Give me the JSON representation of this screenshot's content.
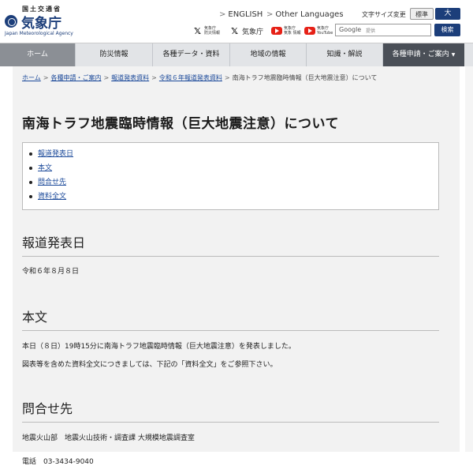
{
  "header": {
    "ministry": "国土交通省",
    "agency_name": "気象庁",
    "agency_en": "Japan Meteorological Agency",
    "lang_en": "ENGLISH",
    "lang_other": "Other Languages",
    "font_size_label": "文字サイズ変更",
    "font_std": "標準",
    "font_large": "大",
    "sns": [
      {
        "icon": "x-icon",
        "label": "気象庁\n防災情報"
      },
      {
        "icon": "x-icon",
        "label": "気象庁"
      },
      {
        "icon": "youtube-icon",
        "label": "気象庁\n気象 情報"
      },
      {
        "icon": "youtube-icon",
        "label": "気象庁\nYouTube"
      }
    ],
    "search_brand": "Google",
    "search_placeholder": "提供",
    "search_button": "検索"
  },
  "nav": {
    "items": [
      "ホーム",
      "防災情報",
      "各種データ・資料",
      "地域の情報",
      "知識・解説",
      "各種申請・ご案内"
    ]
  },
  "breadcrumb": {
    "items": [
      "ホーム",
      "各種申請・ご案内",
      "報道発表資料",
      "令和６年報道発表資料"
    ],
    "current": "南海トラフ地震臨時情報（巨大地震注意）について"
  },
  "page": {
    "title": "南海トラフ地震臨時情報（巨大地震注意）について",
    "toc": [
      "報道発表日",
      "本文",
      "問合せ先",
      "資料全文"
    ],
    "sections": {
      "date_title": "報道発表日",
      "date_value": "令和６年８月８日",
      "body_title": "本文",
      "body_p1": "本日（８日）19時15分に南海トラフ地震臨時情報（巨大地震注意）を発表しました。",
      "body_p2": "図表等を含めた資料全文につきましては、下記の「資料全文」をご参照下さい。",
      "contact_title": "問合せ先",
      "contact_dept": "地震火山部　地震火山技術・調査課 大規模地震調査室",
      "contact_phone": "電話　03-3434-9040"
    }
  },
  "colors": {
    "brand": "#1c3e7a",
    "nav_bg": "#e2e4e7",
    "nav_active": "#8b8f95",
    "nav_last": "#4a4f57",
    "link": "#1c4a9a"
  }
}
